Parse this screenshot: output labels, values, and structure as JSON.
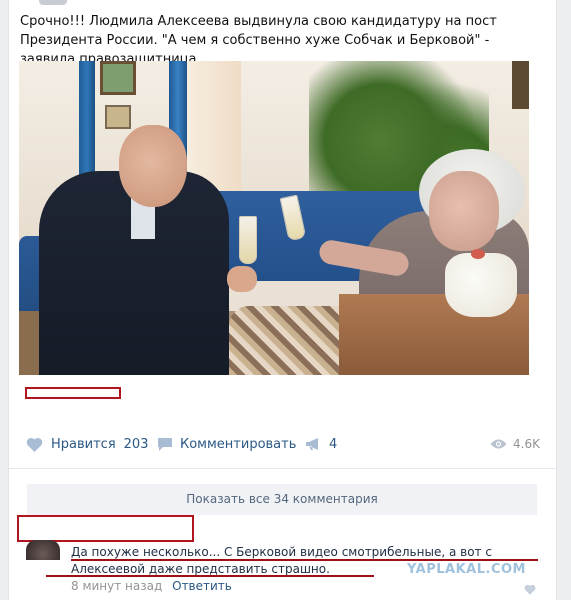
{
  "post": {
    "text": "Срочно!!! Людмила Алексеева выдвинула свою кандидатуру на пост Президента России. \"А чем я собственно хуже Собчак и Берковой\" - заявила правозащитница."
  },
  "actions": {
    "like_label": "Нравится",
    "like_count": "203",
    "comment_label": "Комментировать",
    "share_count": "4",
    "views_count": "4.6K"
  },
  "comments": {
    "show_all_label": "Показать все 34 комментария",
    "items": [
      {
        "text": "Да похуже несколько... С Берковой видео смотрибельные, а вот с Алексеевой даже представить страшно.",
        "time": "8 минут назад",
        "reply_label": "Ответить"
      }
    ]
  },
  "watermark": "YAPLAKAL.COM",
  "colors": {
    "link": "#2a5885",
    "muted": "#939393",
    "annotation_red": "#b1151f",
    "background": "#edeef0"
  },
  "icons": [
    "heart-icon",
    "comment-icon",
    "megaphone-icon",
    "eye-icon"
  ]
}
